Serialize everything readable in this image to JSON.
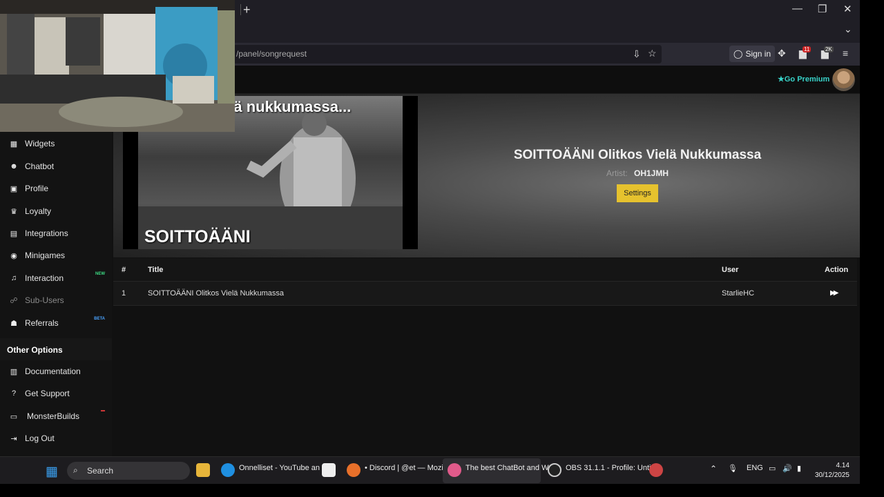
{
  "browser": {
    "new_tab": "+",
    "url": "/panel/songrequest",
    "sign_in": "Sign in",
    "window_controls": {
      "minimize": "—",
      "maximize": "❐",
      "close": "✕"
    },
    "tab_list": "⌄",
    "extension_badge_1": "11",
    "extension_badge_2": "2K"
  },
  "header": {
    "premium_label": "Go Premium"
  },
  "sidebar": {
    "items": [
      {
        "label": "Widgets",
        "icon": "grid-icon",
        "glyph": "▦"
      },
      {
        "label": "Chatbot",
        "icon": "robot-icon",
        "glyph": "☻"
      },
      {
        "label": "Profile",
        "icon": "id-card-icon",
        "glyph": "▣"
      },
      {
        "label": "Loyalty",
        "icon": "trophy-icon",
        "glyph": "♛"
      },
      {
        "label": "Integrations",
        "icon": "plug-icon",
        "glyph": "▤"
      },
      {
        "label": "Minigames",
        "icon": "gamepad-icon",
        "glyph": "◉"
      },
      {
        "label": "Interaction",
        "icon": "music-icon",
        "glyph": "♫",
        "tag": "NEW"
      },
      {
        "label": "Sub-Users",
        "icon": "users-icon",
        "glyph": "☍"
      },
      {
        "label": "Referrals",
        "icon": "user-group-icon",
        "glyph": "☗",
        "tag": "BETA"
      }
    ],
    "other_options_heading": "Other Options",
    "other": [
      {
        "label": "Documentation",
        "icon": "book-icon",
        "glyph": "▥"
      },
      {
        "label": "Get Support",
        "icon": "question-icon",
        "glyph": "?"
      },
      {
        "label": "MonsterBuilds",
        "icon": "laptop-icon",
        "glyph": "▭"
      },
      {
        "label": "Log Out",
        "icon": "logout-icon",
        "glyph": "⇥"
      }
    ]
  },
  "player": {
    "video_caption_top": "elä nukkumassa...",
    "video_caption_bottom": "SOITTOÄÄNI",
    "song_title": "SOITTOÄÄNI Olitkos Vielä Nukkumassa",
    "artist_label": "Artist:",
    "artist_name": "OH1JMH",
    "settings_button": "Settings"
  },
  "queue": {
    "headers": {
      "index": "#",
      "title": "Title",
      "user": "User",
      "action": "Action"
    },
    "rows": [
      {
        "index": "1",
        "title": "SOITTOÄÄNI Olitkos Vielä Nukkumassa",
        "user": "StarlieHC",
        "action_icon": "▶▶"
      }
    ]
  },
  "taskbar": {
    "search": "Search",
    "apps": [
      {
        "label": "Onnelliset - YouTube an",
        "icon": "edge-icon",
        "color": "#1f8fe0"
      },
      {
        "label": "• Discord | @et — Mozil",
        "icon": "firefox-icon",
        "color": "#e8702a"
      },
      {
        "label": "The best ChatBot and W",
        "icon": "firefox-icon",
        "color": "#e05a8a"
      },
      {
        "label": "OBS 31.1.1 - Profile: Unti",
        "icon": "obs-icon",
        "color": "#cccccc"
      }
    ],
    "language": "ENG",
    "time": "4.14",
    "date": "30/12/2025"
  },
  "colors": {
    "accent_premium": "#38d3c9",
    "settings_button": "#e6c22e",
    "tag_new": "#3ddc84",
    "tag_beta": "#4aa3ff",
    "tag_red": "#e03a3a"
  }
}
